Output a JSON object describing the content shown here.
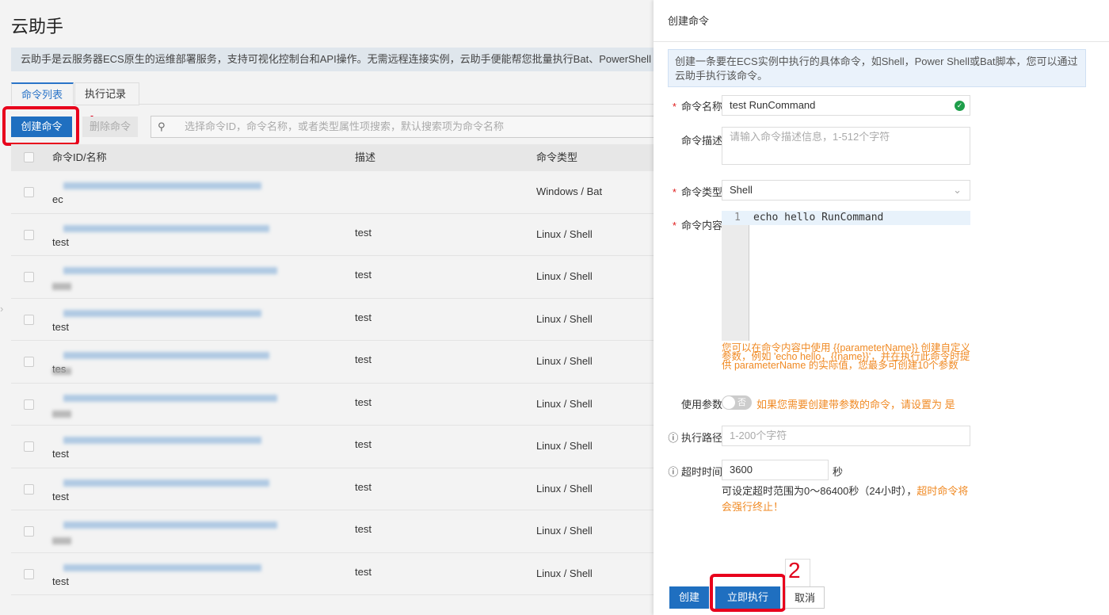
{
  "page": {
    "title": "云助手",
    "info": "云助手是云服务器ECS原生的运维部署服务，支持可视化控制台和API操作。无需远程连接实例，云助手便能帮您批量执行Bat、PowerShell"
  },
  "tabs": [
    {
      "label": "命令列表",
      "active": true
    },
    {
      "label": "执行记录",
      "active": false
    }
  ],
  "toolbar": {
    "create": "创建命令",
    "delete": "删除命令",
    "search_placeholder": "选择命令ID，命令名称，或者类型属性项搜索，默认搜索项为命令名称",
    "step1": "1"
  },
  "table": {
    "headers": [
      "命令ID/名称",
      "描述",
      "命令类型"
    ],
    "rows": [
      {
        "name": "ec",
        "desc": "",
        "type": "Windows / Bat"
      },
      {
        "name": "test",
        "desc": "test",
        "type": "Linux / Shell"
      },
      {
        "name": "",
        "desc": "test",
        "type": "Linux / Shell"
      },
      {
        "name": "test",
        "desc": "test",
        "type": "Linux / Shell"
      },
      {
        "name": "tes",
        "desc": "test",
        "type": "Linux / Shell"
      },
      {
        "name": "",
        "desc": "test",
        "type": "Linux / Shell"
      },
      {
        "name": "test",
        "desc": "test",
        "type": "Linux / Shell"
      },
      {
        "name": "test",
        "desc": "test",
        "type": "Linux / Shell"
      },
      {
        "name": "",
        "desc": "test",
        "type": "Linux / Shell"
      },
      {
        "name": "test",
        "desc": "test",
        "type": "Linux / Shell"
      }
    ]
  },
  "panel": {
    "title": "创建命令",
    "note": "创建一条要在ECS实例中执行的具体命令，如Shell，Power Shell或Bat脚本，您可以通过云助手执行该命令。",
    "name_label": "命令名称",
    "name_value": "test RunCommand",
    "desc_label": "命令描述",
    "desc_placeholder": "请输入命令描述信息，1-512个字符",
    "type_label": "命令类型",
    "type_value": "Shell",
    "content_label": "命令内容",
    "line_no": "1",
    "content_value": "echo hello RunCommand",
    "content_hint": "您可以在命令内容中使用 {{parameterName}} 创建自定义参数，例如 'echo hello，{{name}}'，并在执行此命令时提供 parameterName 的实际值，您最多可创建10个参数",
    "param_label": "使用参数",
    "param_toggle": "否",
    "param_hint": "如果您需要创建带参数的命令，请设置为 是",
    "path_label": "执行路径",
    "path_placeholder": "1-200个字符",
    "timeout_label": "超时时间",
    "timeout_value": "3600",
    "timeout_unit": "秒",
    "timeout_hint": "可设定超时范围为0～86400秒（24小时），",
    "timeout_warn": "超时命令将会强行终止！",
    "btn_create": "创建",
    "btn_run": "立即执行",
    "btn_cancel": "取消",
    "step2": "2"
  },
  "colors": {
    "primary": "#1f6fc0",
    "highlight": "#e8001c",
    "warning": "#f08a24"
  }
}
